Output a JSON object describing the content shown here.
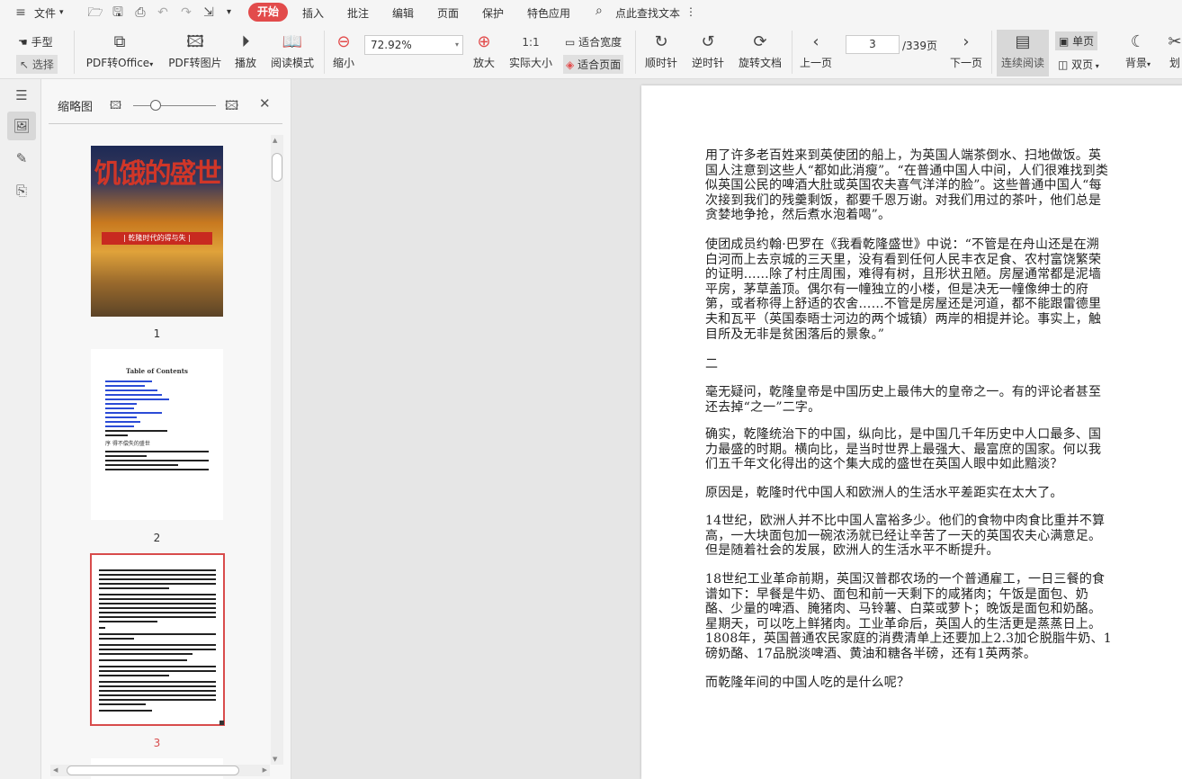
{
  "menubar": {
    "file_label": "文件",
    "tabs": [
      "开始",
      "插入",
      "批注",
      "编辑",
      "页面",
      "保护",
      "特色应用"
    ],
    "search_label": "点此查找文本"
  },
  "toolbar": {
    "hand": "手型",
    "select": "选择",
    "pdf_office": "PDF转Office",
    "pdf_image": "PDF转图片",
    "play": "播放",
    "read_mode": "阅读模式",
    "zoom_out": "缩小",
    "zoom_value": "72.92%",
    "zoom_in": "放大",
    "actual_size": "实际大小",
    "fit_width": "适合宽度",
    "fit_page": "适合页面",
    "rotate_cw": "顺时针",
    "rotate_ccw": "逆时针",
    "rotate_doc": "旋转文档",
    "prev_page": "上一页",
    "page_current": "3",
    "page_total": "/339页",
    "next_page": "下一页",
    "continuous": "连续阅读",
    "single": "单页",
    "double": "双页",
    "background": "背景",
    "cut": "划"
  },
  "thumbs": {
    "title": "缩略图",
    "p1": "1",
    "p2": "2",
    "p3": "3",
    "cover_title": "饥饿的盛世",
    "cover_sub": "| 乾隆时代的得与失 |",
    "toc_title": "Table of Contents",
    "toc_line": "序 得不偿失的盛世"
  },
  "page": {
    "paragraphs": [
      "用了许多老百姓来到英使团的船上，为英国人端茶倒水、扫地做饭。英国人注意到这些人“都如此消瘦”。“在普通中国人中间，人们很难找到类似英国公民的啤酒大肚或英国农夫喜气洋洋的脸”。这些普通中国人“每次接到我们的残羹剩饭，都要千恩万谢。对我们用过的茶叶，他们总是贪婪地争抢，然后煮水泡着喝”。",
      "使团成员约翰·巴罗在《我看乾隆盛世》中说：“不管是在舟山还是在溯白河而上去京城的三天里，没有看到任何人民丰衣足食、农村富饶繁荣的证明……除了村庄周围，难得有树，且形状丑陋。房屋通常都是泥墙平房，茅草盖顶。偶尔有一幢独立的小楼，但是决无一幢像绅士的府第，或者称得上舒适的农舍……不管是房屋还是河道，都不能跟雷德里夫和瓦平（英国泰晤士河边的两个城镇）两岸的相提并论。事实上，触目所及无非是贫困落后的景象。”",
      "二",
      "毫无疑问，乾隆皇帝是中国历史上最伟大的皇帝之一。有的评论者甚至还去掉“之一”二字。",
      "确实，乾隆统治下的中国，纵向比，是中国几千年历史中人口最多、国力最盛的时期。横向比，是当时世界上最强大、最富庶的国家。何以我们五千年文化得出的这个集大成的盛世在英国人眼中如此黯淡？",
      "原因是，乾隆时代中国人和欧洲人的生活水平差距实在太大了。",
      "14世纪，欧洲人并不比中国人富裕多少。他们的食物中肉食比重并不算高，一大块面包加一碗浓汤就已经让辛苦了一天的英国农夫心满意足。但是随着社会的发展，欧洲人的生活水平不断提升。",
      "18世纪工业革命前期，英国汉普郡农场的一个普通雇工，一日三餐的食谱如下：早餐是牛奶、面包和前一天剩下的咸猪肉；午饭是面包、奶酪、少量的啤酒、腌猪肉、马铃薯、白菜或萝卜；晚饭是面包和奶酪。星期天，可以吃上鲜猪肉。工业革命后，英国人的生活更是蒸蒸日上。1808年，英国普通农民家庭的消费清单上还要加上2.3加仑脱脂牛奶、1磅奶酪、17品脱淡啤酒、黄油和糖各半磅，还有1英两茶。",
      "而乾隆年间的中国人吃的是什么呢？"
    ]
  }
}
